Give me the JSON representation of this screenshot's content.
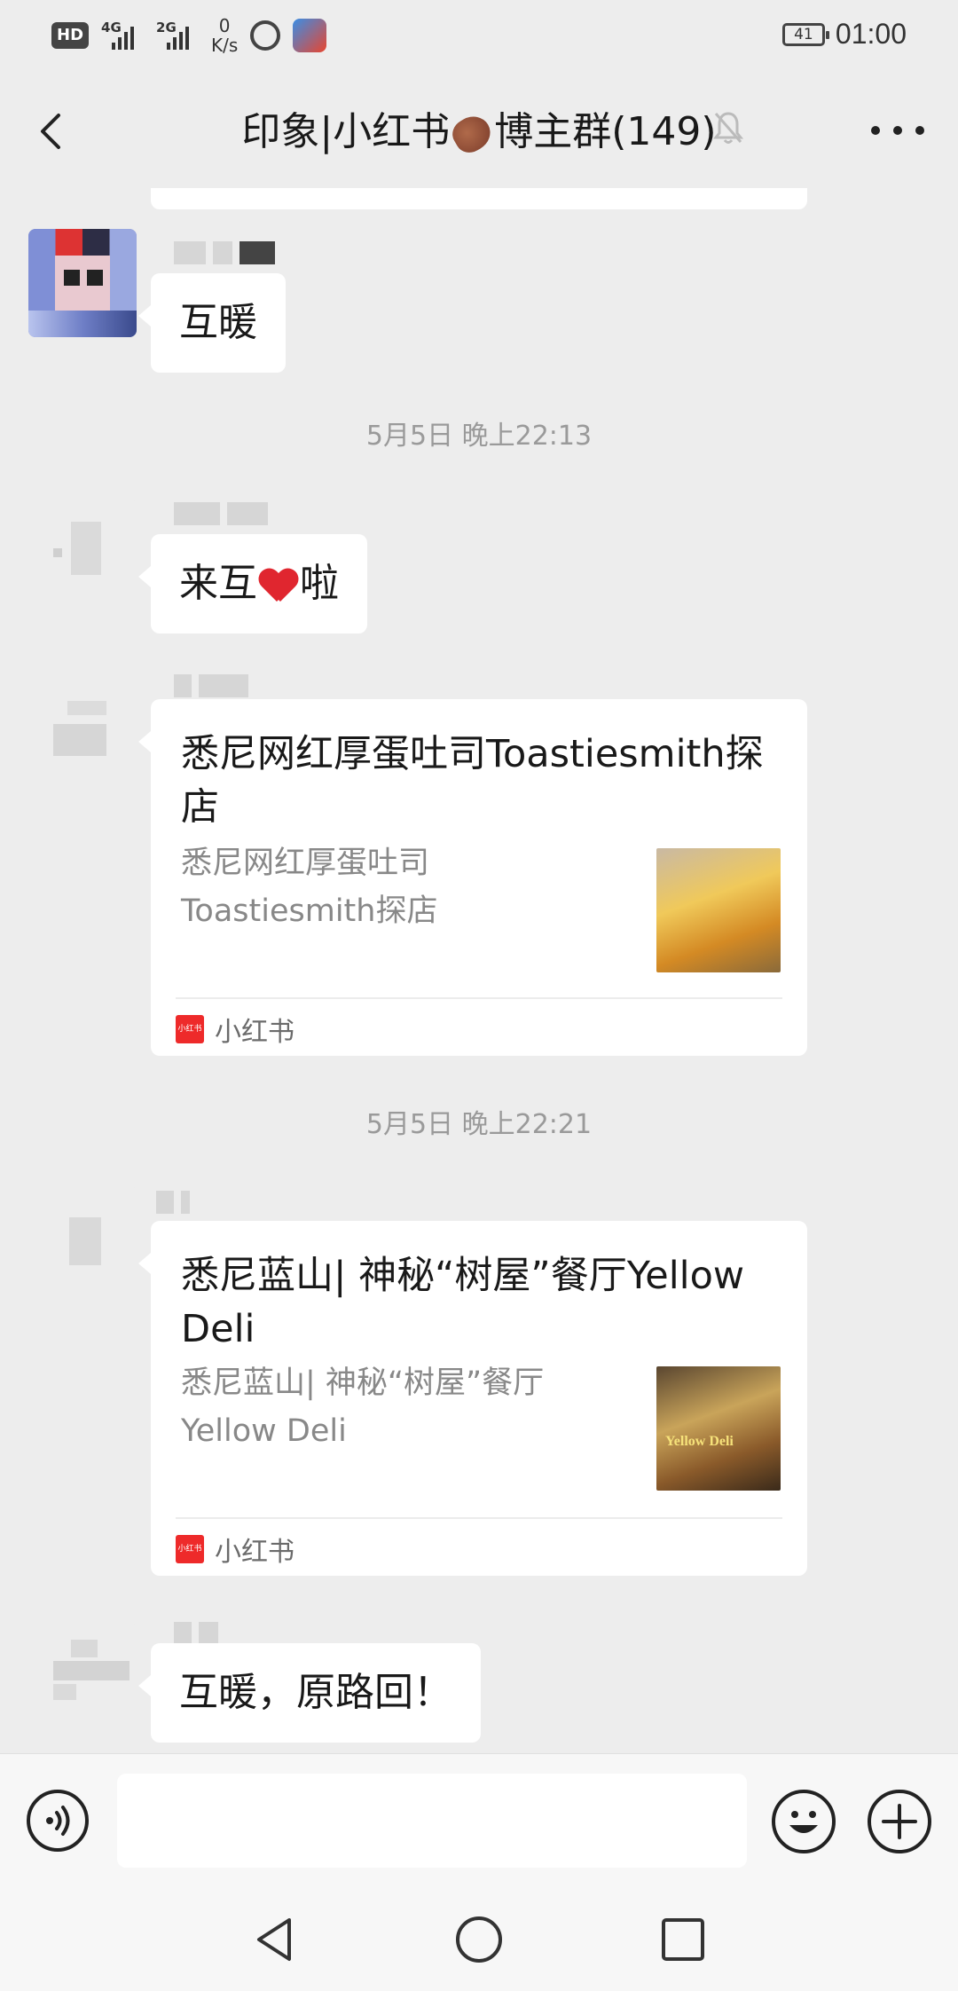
{
  "status_bar": {
    "hd": "HD",
    "net1": "4G",
    "net2": "2G",
    "speed_value": "0",
    "speed_unit": "K/s",
    "battery": "41",
    "time": "01:00"
  },
  "nav": {
    "title_prefix": "印象|小红书",
    "title_suffix": "博主群(149)"
  },
  "messages": {
    "m1_text": "互暖",
    "ts1": "5月5日 晚上22:13",
    "m2_before": "来互",
    "m2_after": "啦",
    "card1": {
      "title": "悉尼网红厚蛋吐司Toastiesmith探店",
      "desc_line1": "悉尼网红厚蛋吐司",
      "desc_line2": "Toastiesmith探店",
      "source": "小红书",
      "logo_text": "小红书"
    },
    "ts2": "5月5日 晚上22:21",
    "card2": {
      "title": "悉尼蓝山| 神秘“树屋”餐厅Yellow Deli",
      "desc_line1": "悉尼蓝山| 神秘“树屋”餐厅",
      "desc_line2": "Yellow Deli",
      "source": "小红书",
      "logo_text": "小红书",
      "thumb_text": "Yellow Deli"
    },
    "m5_text": "互暖，原路回！"
  },
  "input": {
    "placeholder": ""
  },
  "colors": {
    "background": "#ededed",
    "bubble": "#ffffff",
    "brand_red": "#ee2a2a",
    "timestamp": "#9a9a9a"
  }
}
